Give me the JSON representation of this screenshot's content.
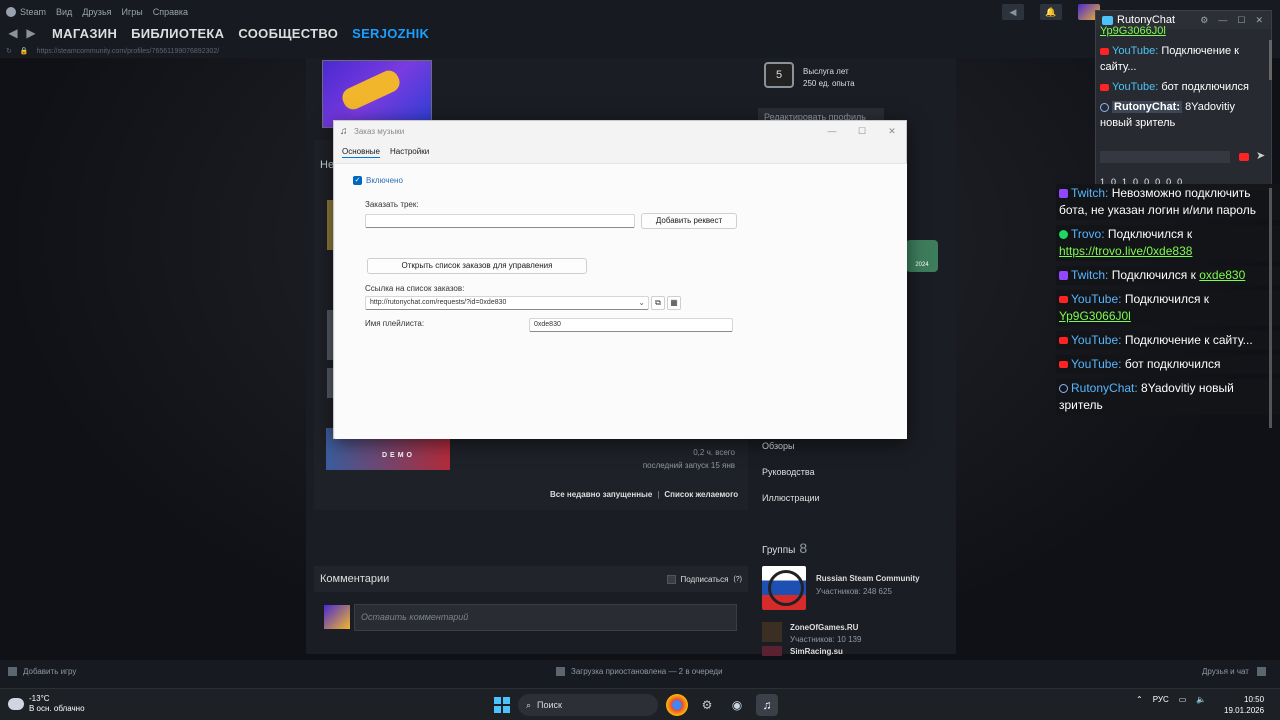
{
  "steam": {
    "menu": [
      "Steam",
      "Вид",
      "Друзья",
      "Игры",
      "Справка"
    ],
    "nav": {
      "store": "МАГАЗИН",
      "library": "БИБЛИОТЕКА",
      "community": "СООБЩЕСТВО",
      "user": "SERJOZHIK"
    },
    "url": "https://steamcommunity.com/profiles/76561199076892302/",
    "profile": {
      "section_label": "Не",
      "xp_level": "5",
      "xp_title": "Выслуга лет",
      "xp_points": "250 ед. опыта",
      "edit_profile": "Редактировать профиль",
      "badge_year": "2024",
      "game_thumb_text": "DEMO",
      "game_hours": "0,2 ч. всего",
      "game_last_launch": "последний запуск 15 янв",
      "link_recent": "Все недавно запущенные",
      "link_wishlist": "Список желаемого",
      "side_links": [
        "Обзоры",
        "Руководства",
        "Иллюстрации"
      ],
      "groups_title": "Группы",
      "groups_count": "8",
      "groups": [
        {
          "name": "Russian Steam Community",
          "members": "Участников: 248 625"
        },
        {
          "name": "ZoneOfGames.RU",
          "members": "Участников: 10 139"
        },
        {
          "name": "SimRacing.su",
          "members": ""
        }
      ],
      "comments_title": "Комментарии",
      "subscribe": "Подписаться",
      "subscribe_help": "(?)",
      "comment_placeholder": "Оставить комментарий"
    },
    "bottom": {
      "add_game": "Добавить игру",
      "download_status": "Загрузка приостановлена — 2 в очереди",
      "friends_chat": "Друзья и чат"
    }
  },
  "dialog": {
    "title": "Заказ музыки",
    "tabs": [
      "Основные",
      "Настройки"
    ],
    "enabled_label": "Включено",
    "order_track_label": "Заказать трек:",
    "order_track_value": "",
    "add_request_button": "Добавить реквест",
    "open_list_button": "Открыть список заказов для управления",
    "list_link_label": "Ссылка на список заказов:",
    "list_link_value": "http://rutonychat.com/requests/?id=0xde830",
    "playlist_label": "Имя плейлиста:",
    "playlist_value": "0xde830"
  },
  "rutony": {
    "title": "RutonyChat",
    "messages": [
      {
        "platform": "youtube",
        "user": "",
        "text": "",
        "link": "Yp9G3066J0l"
      },
      {
        "platform": "youtube",
        "user": "YouTube:",
        "text": "Подключение к сайту..."
      },
      {
        "platform": "youtube",
        "user": "YouTube:",
        "text": "бот подключился"
      },
      {
        "platform": "rutony",
        "user": "RutonyChat:",
        "text": "8Yadovitiy новый зритель"
      }
    ],
    "stats": [
      "1",
      "0",
      "1",
      "0",
      "0",
      "0",
      "0",
      "0"
    ]
  },
  "overlay": [
    {
      "platform": "twitch",
      "user": "Twitch:",
      "text": "Невозможно подключить бота, не указан логин и/или пароль"
    },
    {
      "platform": "trovo",
      "user": "Trovo:",
      "text": "Подключился к",
      "link": "https://trovo.live/0xde838"
    },
    {
      "platform": "twitch",
      "user": "Twitch:",
      "text": "Подключился к",
      "link": "oxde830"
    },
    {
      "platform": "youtube",
      "user": "YouTube:",
      "text": "Подключился к",
      "link": "Yp9G3066J0l"
    },
    {
      "platform": "youtube",
      "user": "YouTube:",
      "text": "Подключение к сайту..."
    },
    {
      "platform": "youtube",
      "user": "YouTube:",
      "text": "бот подключился"
    },
    {
      "platform": "rutony",
      "user": "RutonyChat:",
      "text": "8Yadovitiy новый зритель"
    }
  ],
  "taskbar": {
    "temperature": "-13°C",
    "weather": "В осн. облачно",
    "search": "Поиск",
    "language": "РУС",
    "time": "10:50",
    "date": "19.01.2026"
  },
  "colors": {
    "accent": "#1a9fff",
    "twitch": "#9146ff",
    "youtube": "#ff2323",
    "link_green": "#7cfc4f"
  }
}
